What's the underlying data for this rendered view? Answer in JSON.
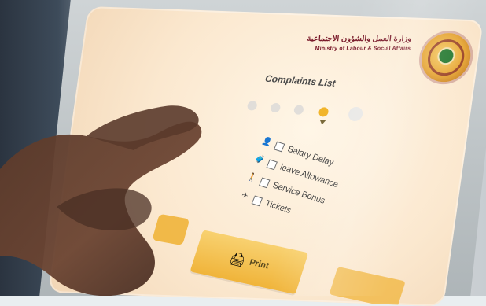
{
  "screen": {
    "header_arabic": "وزارة العمل والشؤون الاجتماعية",
    "header_english": "Ministry of Labour & Social Affairs",
    "title": "Complaints List",
    "menu_items": [
      {
        "label": "Salary Delay",
        "icon": "person-icon"
      },
      {
        "label": "leave Allowance",
        "icon": "suitcase-icon"
      },
      {
        "label": "Service Bonus",
        "icon": "walking-icon"
      },
      {
        "label": "Tickets",
        "icon": "plane-icon"
      }
    ],
    "print_button": {
      "label": "Print",
      "icon": "printer-icon"
    }
  },
  "colors": {
    "screen_bg": "#fff6e7",
    "accent_yellow": "#f0b43a",
    "header_maroon": "#7a1a2a"
  }
}
